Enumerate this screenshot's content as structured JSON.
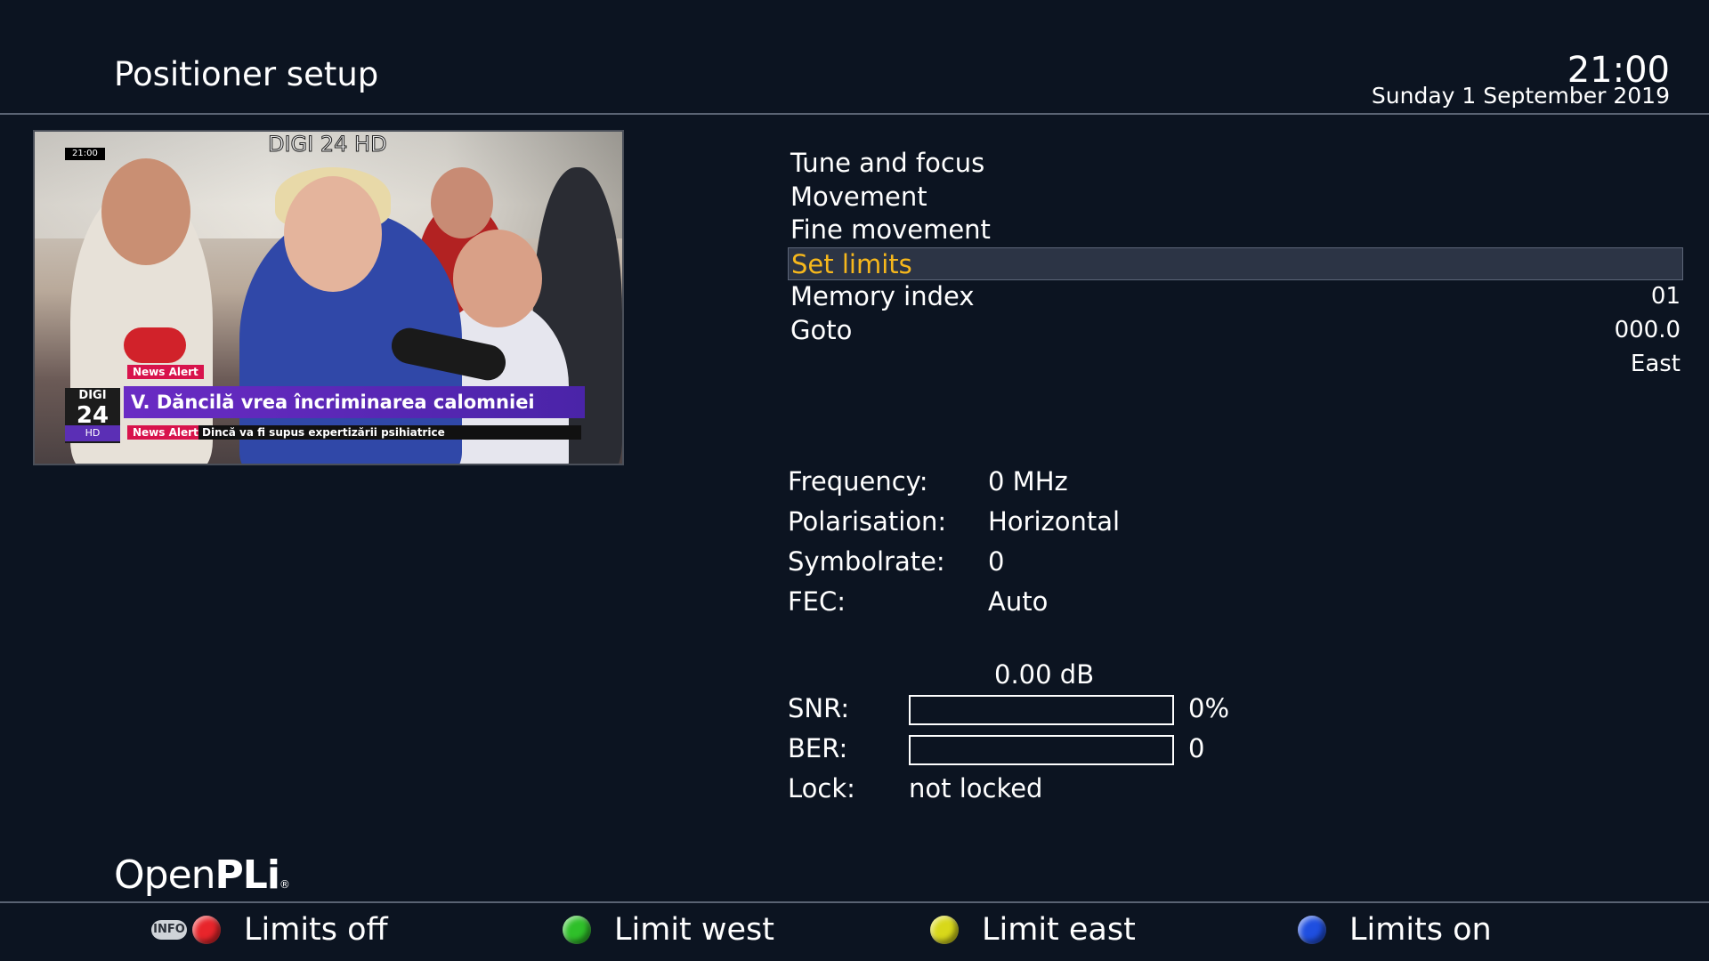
{
  "header": {
    "title": "Positioner setup",
    "time": "21:00",
    "date": "Sunday 1 September 2019"
  },
  "video": {
    "channel_name": "DIGI 24 HD",
    "clock": "21:00",
    "logo_top": "DIGI",
    "logo_number": "24",
    "logo_hd": "HD",
    "alert_tag": "News Alert",
    "headline": "V. Dăncilă vrea încriminarea calomniei",
    "ticker_tag": "News Alert",
    "ticker": "Dincă va fi supus expertizării psihiatrice"
  },
  "menu": {
    "items": [
      {
        "label": "Tune and focus",
        "value": ""
      },
      {
        "label": "Movement",
        "value": ""
      },
      {
        "label": "Fine movement",
        "value": ""
      },
      {
        "label": "Set limits",
        "value": ""
      },
      {
        "label": "Memory index",
        "value": "01"
      },
      {
        "label": "Goto",
        "value": "000.0"
      }
    ],
    "selected_index": 3,
    "goto_direction": "East"
  },
  "tuning": {
    "frequency_label": "Frequency:",
    "frequency_value": "0 MHz",
    "polarisation_label": "Polarisation:",
    "polarisation_value": "Horizontal",
    "symbolrate_label": "Symbolrate:",
    "symbolrate_value": "0",
    "fec_label": "FEC:",
    "fec_value": "Auto"
  },
  "signal": {
    "snr_db": "0.00 dB",
    "snr_label": "SNR:",
    "snr_value": "0%",
    "snr_fraction": 0,
    "ber_label": "BER:",
    "ber_value": "0",
    "ber_fraction": 0,
    "lock_label": "Lock:",
    "lock_value": "not locked"
  },
  "brand": {
    "part1": "Open",
    "part2": "PLi",
    "mark": "®"
  },
  "footer": {
    "info_badge": "INFO",
    "keys": [
      {
        "color": "#e8252b",
        "label": "Limits off"
      },
      {
        "color": "#2fc02a",
        "label": "Limit west"
      },
      {
        "color": "#d8d81a",
        "label": "Limit east"
      },
      {
        "color": "#1f4fe0",
        "label": "Limits on"
      }
    ]
  },
  "colors": {
    "background": "#0c1421",
    "selected_text": "#f6b71c",
    "selected_bg": "#2c3445"
  }
}
